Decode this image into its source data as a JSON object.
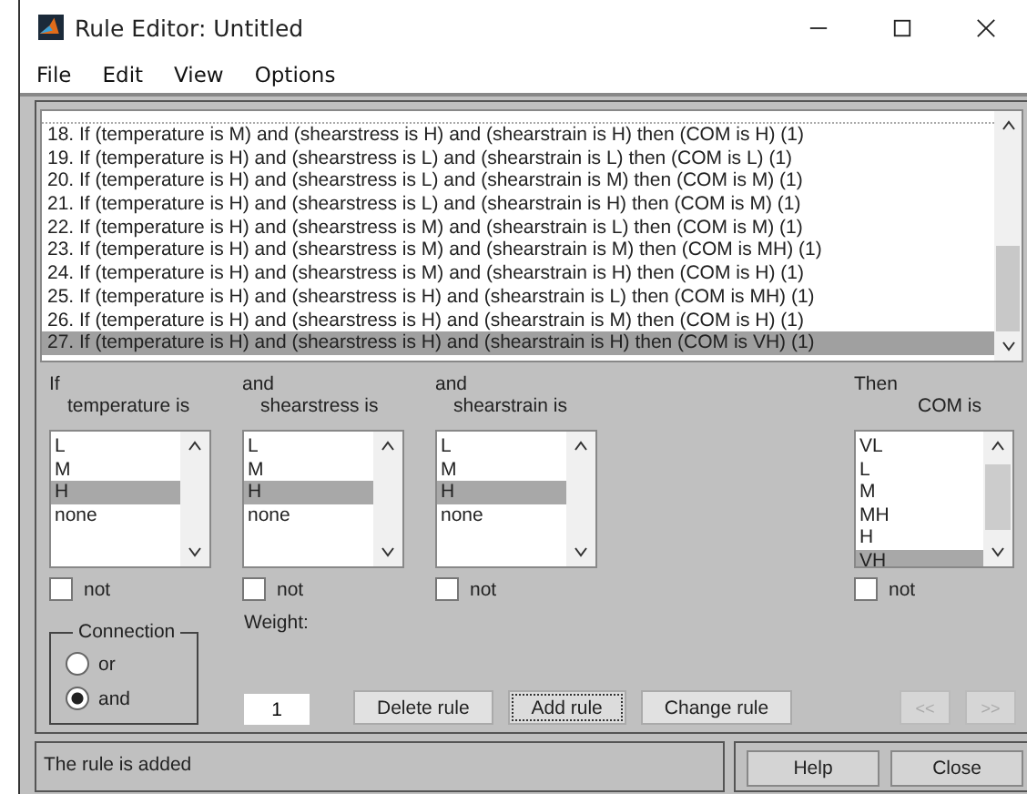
{
  "window": {
    "title": "Rule Editor: Untitled"
  },
  "menu": [
    "File",
    "Edit",
    "View",
    "Options"
  ],
  "rules": [
    {
      "text": "18. If (temperature is M) and (shearstress is H) and (shearstrain is H) then (COM is H) (1)",
      "selected": false
    },
    {
      "text": "19. If (temperature is H) and (shearstress is L) and (shearstrain is L) then (COM is L) (1)",
      "selected": false
    },
    {
      "text": "20. If (temperature is H) and (shearstress is L) and (shearstrain is M) then (COM is M) (1)",
      "selected": false
    },
    {
      "text": "21. If (temperature is H) and (shearstress is L) and (shearstrain is H) then (COM is M) (1)",
      "selected": false
    },
    {
      "text": "22. If (temperature is H) and (shearstress is M) and (shearstrain is L) then (COM is M) (1)",
      "selected": false
    },
    {
      "text": "23. If (temperature is H) and (shearstress is M) and (shearstrain is M) then (COM is MH) (1)",
      "selected": false
    },
    {
      "text": "24. If (temperature is H) and (shearstress is M) and (shearstrain is H) then (COM is H) (1)",
      "selected": false
    },
    {
      "text": "25. If (temperature is H) and (shearstress is H) and (shearstrain is L) then (COM is MH) (1)",
      "selected": false
    },
    {
      "text": "26. If (temperature is H) and (shearstress is H) and (shearstrain is M) then (COM is H) (1)",
      "selected": false
    },
    {
      "text": "27. If (temperature is H) and (shearstress is H) and (shearstrain is H) then (COM is VH) (1)",
      "selected": true
    }
  ],
  "inputs": [
    {
      "prefix": "If",
      "label": "temperature is",
      "items": [
        {
          "text": "L",
          "selected": false
        },
        {
          "text": "M",
          "selected": false
        },
        {
          "text": "H",
          "selected": true
        },
        {
          "text": "none",
          "selected": false
        }
      ],
      "not_label": "not",
      "not_checked": false
    },
    {
      "prefix": "and",
      "label": "shearstress is",
      "items": [
        {
          "text": "L",
          "selected": false
        },
        {
          "text": "M",
          "selected": false
        },
        {
          "text": "H",
          "selected": true
        },
        {
          "text": "none",
          "selected": false
        }
      ],
      "not_label": "not",
      "not_checked": false
    },
    {
      "prefix": "and",
      "label": "shearstrain is",
      "items": [
        {
          "text": "L",
          "selected": false
        },
        {
          "text": "M",
          "selected": false
        },
        {
          "text": "H",
          "selected": true
        },
        {
          "text": "none",
          "selected": false
        }
      ],
      "not_label": "not",
      "not_checked": false
    }
  ],
  "output": {
    "prefix": "Then",
    "label": "COM is",
    "items": [
      {
        "text": "VL",
        "selected": false
      },
      {
        "text": "L",
        "selected": false
      },
      {
        "text": "M",
        "selected": false
      },
      {
        "text": "MH",
        "selected": false
      },
      {
        "text": "H",
        "selected": false
      },
      {
        "text": "VH",
        "selected": true
      }
    ],
    "not_label": "not",
    "not_checked": false
  },
  "connection": {
    "title": "Connection",
    "options": [
      {
        "label": "or",
        "selected": false
      },
      {
        "label": "and",
        "selected": true
      }
    ]
  },
  "weight": {
    "label": "Weight:",
    "value": "1"
  },
  "buttons": [
    {
      "label": "Delete rule",
      "focused": false
    },
    {
      "label": "Add rule",
      "focused": true
    },
    {
      "label": "Change rule",
      "focused": false
    }
  ],
  "nav_buttons": [
    {
      "label": "<<",
      "disabled": true
    },
    {
      "label": ">>",
      "disabled": true
    }
  ],
  "status": "The rule is added",
  "footer_buttons": [
    "Help",
    "Close"
  ]
}
